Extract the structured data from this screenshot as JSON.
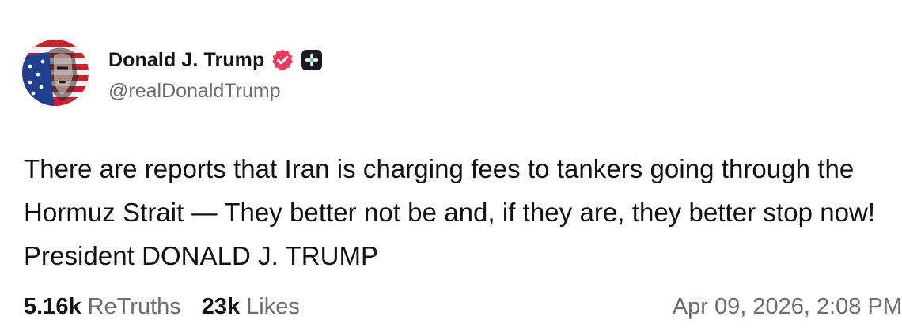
{
  "post": {
    "author": {
      "display_name": "Donald J. Trump",
      "handle": "@realDonaldTrump",
      "verified_icon": "verified-badge-icon",
      "plus_icon": "plus-badge-icon"
    },
    "text": "There are reports that Iran is charging fees to tankers going through the Hormuz Strait — They better not be and, if they are, they better stop now! President DONALD J. TRUMP",
    "stats": {
      "retruths_count": "5.16k",
      "retruths_label": "ReTruths",
      "likes_count": "23k",
      "likes_label": "Likes"
    },
    "timestamp": "Apr 09, 2026, 2:08 PM"
  },
  "colors": {
    "verified_badge": "#f2395b",
    "plus_badge": "#1a1a22",
    "muted_text": "#6b6b78"
  }
}
